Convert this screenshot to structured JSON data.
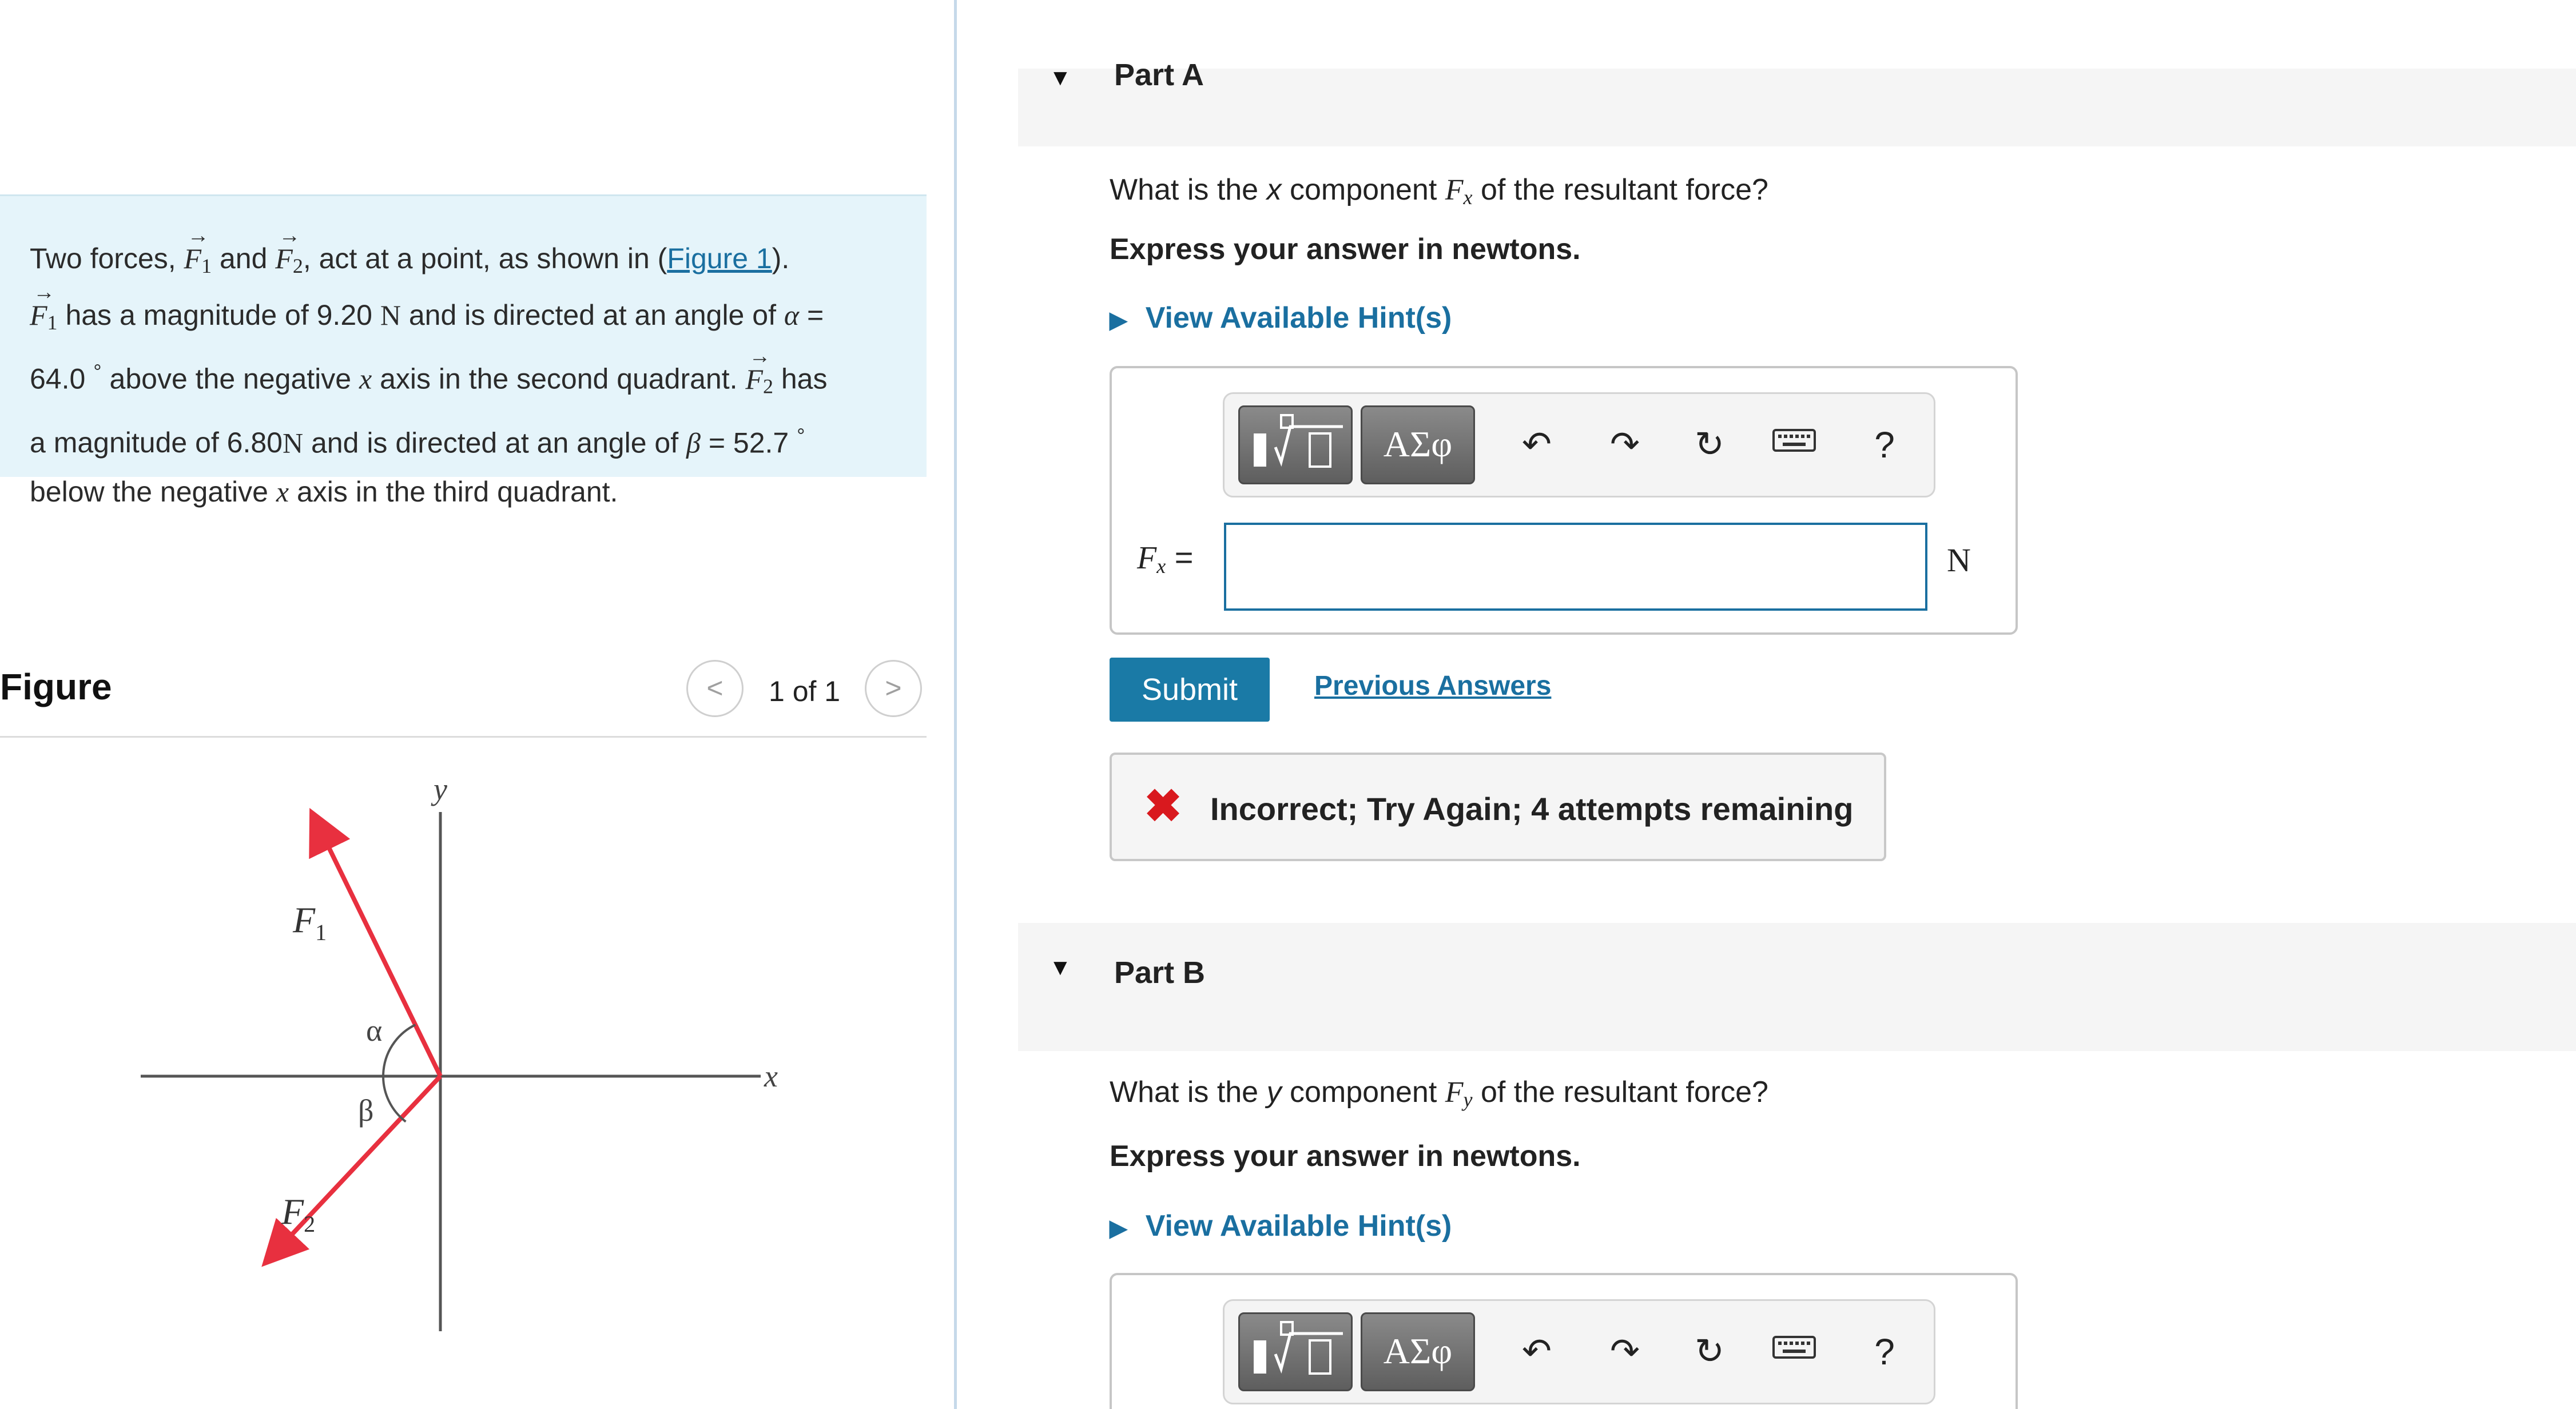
{
  "problem": {
    "p1": "Two forces, ",
    "f1_sym": "F",
    "f1_sub": "1",
    "and": " and ",
    "f2_sym": "F",
    "f2_sub": "2",
    "p2": ", act at a point, as shown in (",
    "figure_link": "Figure 1",
    "p3": ").",
    "p4": " has a magnitude of 9.20 ",
    "unit_n": "N",
    "p5": " and is directed at an angle of ",
    "alpha": "α",
    "eq": " = ",
    "alpha_val": "64.0",
    "deg": "°",
    "p6": " above the negative ",
    "x": "x",
    "p7": " axis in the second quadrant. ",
    "p8": " has a magnitude of 6.80 ",
    "p9": " and is directed at an angle of ",
    "beta": "β",
    "beta_val": " = 52.7 ",
    "p10": "below the negative ",
    "p11": " axis in the third quadrant."
  },
  "figure": {
    "title": "Figure",
    "pager": "1 of 1",
    "prev_icon": "chevron-left-icon",
    "next_icon": "chevron-right-icon",
    "labels": {
      "y": "y",
      "x": "x",
      "f1": "F",
      "f1_sub": "1",
      "f2": "F",
      "f2_sub": "2",
      "alpha": "α",
      "beta": "β"
    },
    "alpha_deg": 64.0,
    "beta_deg": 52.7,
    "force_color": "#e8303f"
  },
  "partA": {
    "title": "Part A",
    "question_pre": "What is the ",
    "axis": "x",
    "question_mid": " component ",
    "sym": "F",
    "sym_sub": "x",
    "question_post": " of the resultant force?",
    "instruction": "Express your answer in newtons.",
    "hint": "View Available Hint(s)",
    "label_sym": "F",
    "label_sub": "x",
    "label_eq": " =",
    "input_value": "",
    "unit": "N",
    "submit": "Submit",
    "previous_answers": "Previous Answers",
    "feedback": "Incorrect; Try Again; 4 attempts remaining"
  },
  "partB": {
    "title": "Part B",
    "question_pre": "What is the ",
    "axis": "y",
    "question_mid": " component ",
    "sym": "F",
    "sym_sub": "y",
    "question_post": " of the resultant force?",
    "instruction": "Express your answer in newtons.",
    "hint": "View Available Hint(s)"
  },
  "toolbar": {
    "symbols": "ΑΣφ",
    "help": "?",
    "icons": [
      "templates-icon",
      "undo-icon",
      "redo-icon",
      "reset-icon",
      "keyboard-icon",
      "help-icon"
    ]
  },
  "colors": {
    "link": "#1a6fa0",
    "submit": "#1a7aa6",
    "problem_bg": "#e5f4fa",
    "error": "#d9191e"
  }
}
